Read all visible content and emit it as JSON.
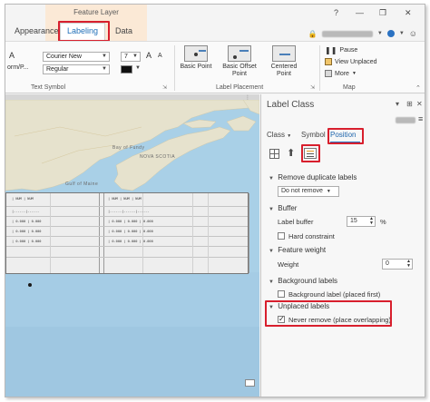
{
  "titlebar": {
    "context_label": "Feature Layer",
    "help": "?",
    "minimize": "—",
    "restore": "❐",
    "close": "✕"
  },
  "tabs": [
    {
      "label": "Appearance"
    },
    {
      "label": "Labeling"
    },
    {
      "label": "Data"
    }
  ],
  "ribbon": {
    "text_symbol": {
      "font_name": "Courier New",
      "font_size": "7",
      "font_style": "Regular",
      "partial_left_1": "A",
      "partial_left_2": "orm/P...",
      "grow_font": "A",
      "shrink_font": "A",
      "group_label": "Text Symbol"
    },
    "label_placement": {
      "buttons": [
        {
          "label": "Basic Point"
        },
        {
          "label": "Basic Offset Point"
        },
        {
          "label": "Centered Point"
        }
      ],
      "group_label": "Label Placement"
    },
    "map": {
      "pause": "Pause",
      "view_unplaced": "View Unplaced",
      "more": "More",
      "group_label": "Map"
    }
  },
  "map_view": {
    "places": [
      "NOVA SCOTIA",
      "Bay of Fundy",
      "Gulf of Maine"
    ]
  },
  "label_class": {
    "title": "Label Class",
    "subtabs": [
      {
        "label": "Class"
      },
      {
        "label": "Symbol"
      },
      {
        "label": "Position"
      }
    ],
    "remove_duplicates": {
      "header": "Remove duplicate labels",
      "value": "Do not remove"
    },
    "buffer": {
      "header": "Buffer",
      "label_buffer": "Label buffer",
      "value": "15",
      "unit": "%",
      "hard_constraint": "Hard constraint",
      "hard_constraint_checked": false
    },
    "feature_weight": {
      "header": "Feature weight",
      "weight_label": "Weight",
      "value": "0"
    },
    "background_labels": {
      "header": "Background labels",
      "option": "Background label (placed first)",
      "checked": false
    },
    "unplaced_labels": {
      "header": "Unplaced labels",
      "option": "Never remove (place overlapping)",
      "checked": true
    }
  },
  "colors": {
    "highlight_red": "#d81f2d",
    "accent_blue": "#1f6fb8",
    "context_tab": "#fbe9d6",
    "water": "#a9d0e7",
    "land": "#e6e2cd"
  }
}
